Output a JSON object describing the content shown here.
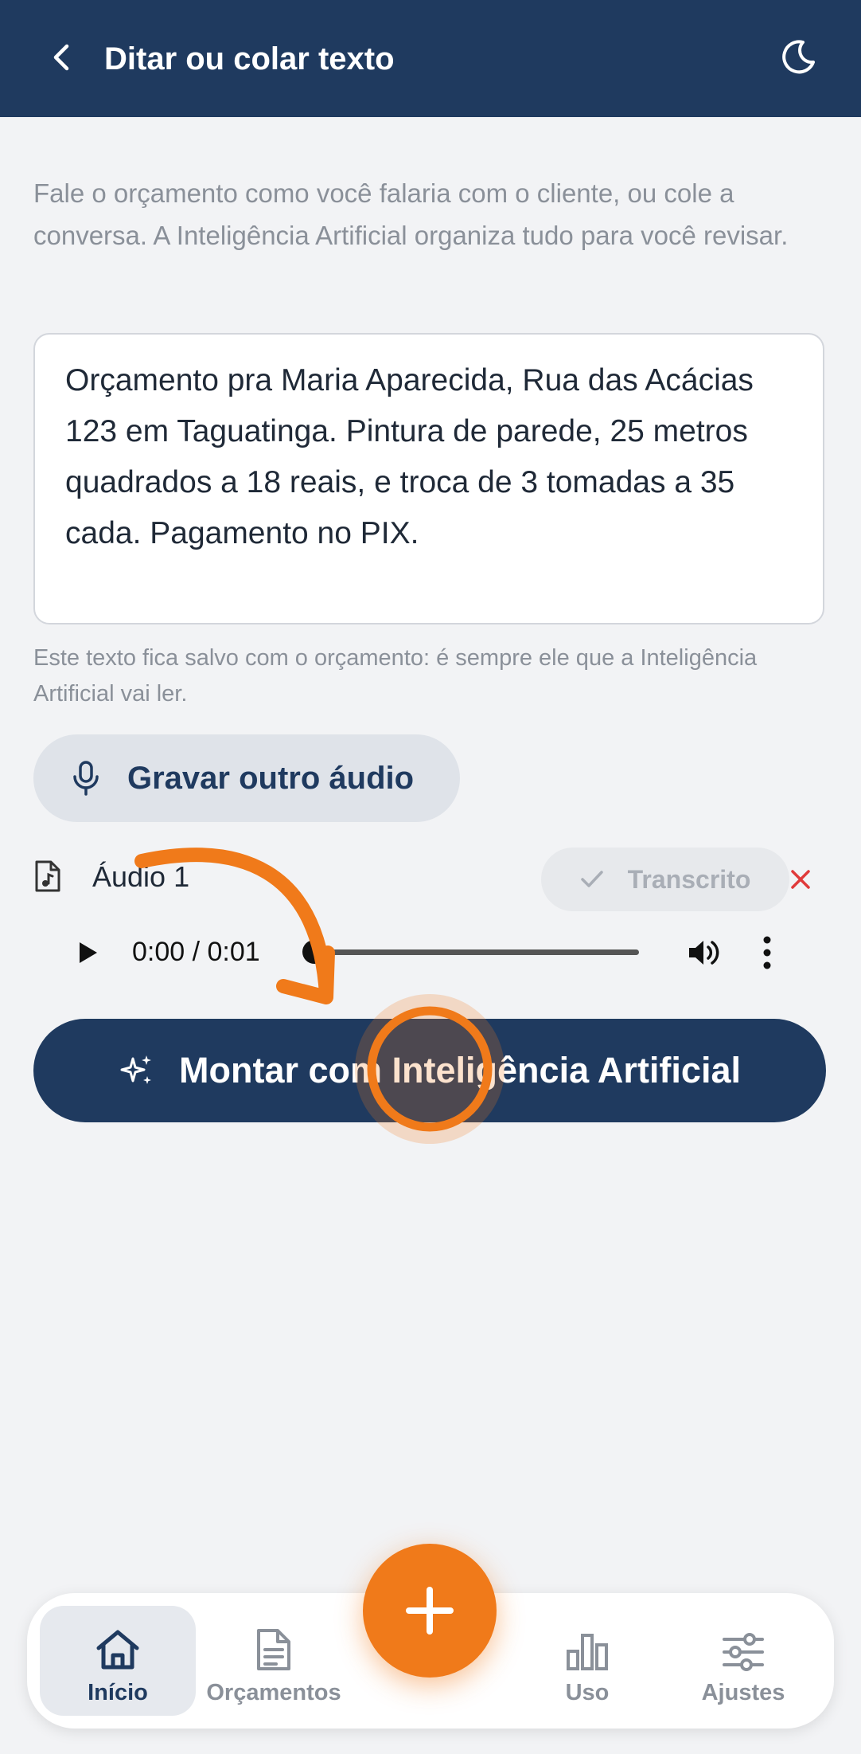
{
  "header": {
    "title": "Ditar ou colar texto",
    "back_icon": "arrow-left-icon",
    "theme_icon": "moon-icon"
  },
  "intro_text": "Fale o orçamento como você falaria com o cliente, ou cole a conversa. A Inteligência Artificial organiza tudo para você revisar.",
  "dictation": {
    "value": "Orçamento pra Maria Aparecida, Rua das Acácias 123 em Taguatinga. Pintura de parede, 25 metros quadrados a 18 reais, e troca de 3 tomadas a 35 cada. Pagamento no PIX."
  },
  "note_text": "Este texto fica salvo com o orçamento: é sempre ele que a Inteligência Artificial vai ler.",
  "record_button": {
    "label": "Gravar outro áudio",
    "icon": "microphone-icon"
  },
  "audio": {
    "name": "Áudio 1",
    "status": "Transcrito",
    "time": "0:00 / 0:01",
    "progress": 0.0
  },
  "main_button": {
    "label": "Montar com Inteligência Artificial",
    "icon": "sparkles-icon"
  },
  "nav": {
    "items": [
      {
        "label": "Início",
        "icon": "home-icon",
        "active": true
      },
      {
        "label": "Orçamentos",
        "icon": "document-icon",
        "active": false
      },
      {
        "label": "Uso",
        "icon": "bar-chart-icon",
        "active": false
      },
      {
        "label": "Ajustes",
        "icon": "sliders-icon",
        "active": false
      }
    ],
    "fab_icon": "plus-icon"
  },
  "colors": {
    "primary": "#1f3a5f",
    "accent": "#f07a1a",
    "danger": "#e03a3a",
    "background": "#f2f3f5"
  }
}
